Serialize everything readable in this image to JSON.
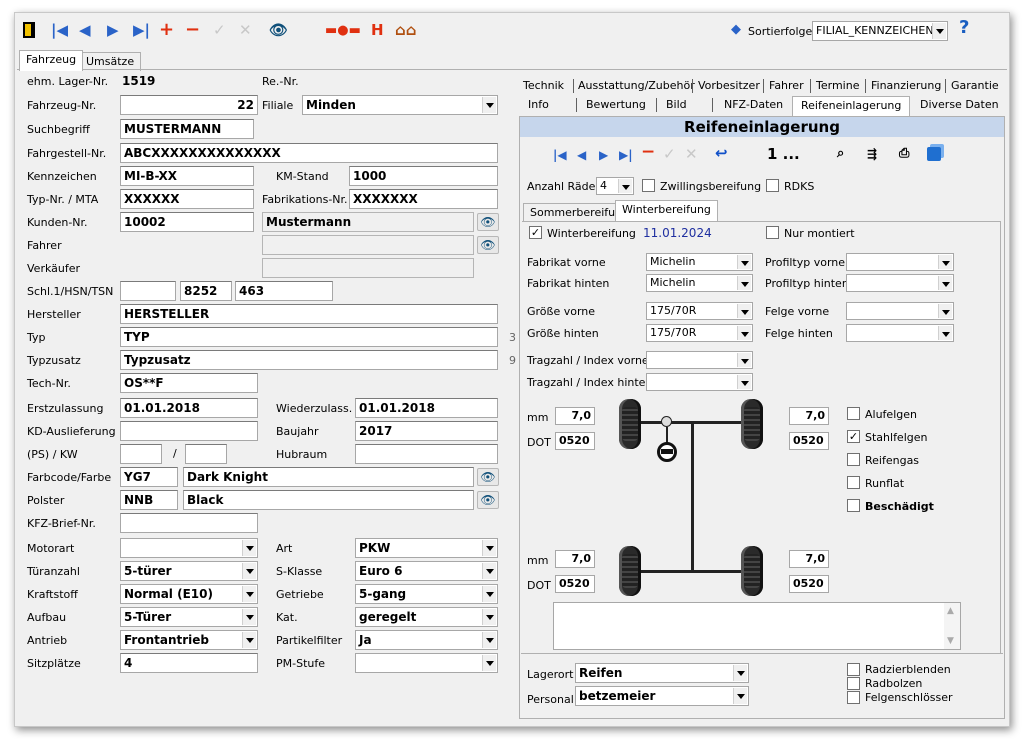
{
  "toolbar": {
    "sort_label": "Sortierfolge",
    "sort_value": "FILIAL_KENNZEICHEN"
  },
  "main_tabs": [
    "Fahrzeug",
    "Umsätze"
  ],
  "left": {
    "lager_label": "ehm. Lager-Nr.",
    "lager_value": "1519",
    "re_label": "Re.-Nr.",
    "fzg_label": "Fahrzeug-Nr.",
    "fzg_value": "22",
    "filiale_label": "Filiale",
    "filiale_value": "Minden",
    "such_label": "Suchbegriff",
    "such_value": "MUSTERMANN",
    "fgst_label": "Fahrgestell-Nr.",
    "fgst_value": "ABCXXXXXXXXXXXXXX",
    "kz_label": "Kennzeichen",
    "kz_value": "MI-B-XX",
    "km_label": "KM-Stand",
    "km_value": "1000",
    "typnr_label": "Typ-Nr. / MTA",
    "typnr_value": "XXXXXX",
    "fabr_label": "Fabrikations-Nr.",
    "fabr_value": "XXXXXXX",
    "kunden_label": "Kunden-Nr.",
    "kunden_value": "10002",
    "kunden_name": "Mustermann",
    "fahrer_label": "Fahrer",
    "verk_label": "Verkäufer",
    "schl_label": "Schl.1/HSN/TSN",
    "hsn_value": "8252",
    "tsn_value": "463",
    "herst_label": "Hersteller",
    "herst_value": "HERSTELLER",
    "typ_label": "Typ",
    "typ_value": "TYP",
    "typ_side": "3",
    "typz_label": "Typzusatz",
    "typz_value": "Typzusatz",
    "typz_side": "9",
    "tech_label": "Tech-Nr.",
    "tech_value": "OS**F",
    "erst_label": "Erstzulassung",
    "erst_value": "01.01.2018",
    "wied_label": "Wiederzulass.",
    "wied_value": "01.01.2018",
    "kd_label": "KD-Auslieferung",
    "bj_label": "Baujahr",
    "bj_value": "2017",
    "ps_label": "(PS) / KW",
    "ps_slash": "/",
    "hub_label": "Hubraum",
    "farb_label": "Farbcode/Farbe",
    "farb_code": "YG7",
    "farb_name": "Dark Knight",
    "polster_label": "Polster",
    "polster_code": "NNB",
    "polster_name": "Black",
    "brief_label": "KFZ-Brief-Nr.",
    "motor_label": "Motorart",
    "motor_value": "",
    "art_label": "Art",
    "art_value": "PKW",
    "tuer_label": "Türanzahl",
    "tuer_value": "5-türer",
    "skl_label": "S-Klasse",
    "skl_value": "Euro 6",
    "kraft_label": "Kraftstoff",
    "kraft_value": "Normal (E10)",
    "getr_label": "Getriebe",
    "getr_value": "5-gang",
    "aufbau_label": "Aufbau",
    "aufbau_value": "5-Türer",
    "kat_label": "Kat.",
    "kat_value": "geregelt",
    "antrieb_label": "Antrieb",
    "antrieb_value": "Frontantrieb",
    "partikel_label": "Partikelfilter",
    "partikel_value": "Ja",
    "sitz_label": "Sitzplätze",
    "sitz_value": "4",
    "pm_label": "PM-Stufe",
    "pm_value": ""
  },
  "right_tabs_row1": [
    "Technik",
    "Ausstattung/Zubehör",
    "Vorbesitzer",
    "Fahrer",
    "Termine",
    "Finanzierung",
    "Garantie"
  ],
  "right_tabs_row2": [
    "Info",
    "Bewertung",
    "Bild",
    "NFZ-Daten",
    "Reifeneinlagerung",
    "Diverse Daten"
  ],
  "reifen": {
    "title": "Reifeneinlagerung",
    "record": "1 ...",
    "anzahl_label": "Anzahl Räder",
    "anzahl_value": "4",
    "zwilling_label": "Zwillingsbereifung",
    "rdks_label": "RDKS",
    "subtabs": [
      "Sommerbereifung",
      "Winterbereifung"
    ],
    "winter_chk_label": "Winterbereifung",
    "winter_date": "11.01.2024",
    "nurmont_label": "Nur montiert",
    "fab_v_label": "Fabrikat vorne",
    "fab_v_value": "Michelin",
    "profil_v_label": "Profiltyp vorne",
    "fab_h_label": "Fabrikat hinten",
    "fab_h_value": "Michelin",
    "profil_h_label": "Profiltyp hinten",
    "gr_v_label": "Größe vorne",
    "gr_v_value": "175/70R",
    "felge_v_label": "Felge vorne",
    "gr_h_label": "Größe hinten",
    "gr_h_value": "175/70R",
    "felge_h_label": "Felge hinten",
    "trag_v_label": "Tragzahl / Index vorne",
    "trag_h_label": "Tragzahl / Index hinten",
    "mm_label": "mm",
    "dot_label": "DOT",
    "fl_mm": "7,0",
    "fl_dot": "0520",
    "fr_mm": "7,0",
    "fr_dot": "0520",
    "rl_mm": "7,0",
    "rl_dot": "0520",
    "rr_mm": "7,0",
    "rr_dot": "0520",
    "alu_label": "Alufelgen",
    "stahl_label": "Stahlfelgen",
    "gas_label": "Reifengas",
    "runflat_label": "Runflat",
    "besch_label": "Beschädigt",
    "lagerort_label": "Lagerort",
    "lagerort_value": "Reifen",
    "personal_label": "Personal",
    "personal_value": "betzemeier",
    "radzier_label": "Radzierblenden",
    "radbolzen_label": "Radbolzen",
    "felgensch_label": "Felgenschlösser"
  },
  "colors": {
    "header_bg": "#c6d6ec",
    "accent_blue": "#2a63c8",
    "date_blue": "#1f2fa0"
  }
}
